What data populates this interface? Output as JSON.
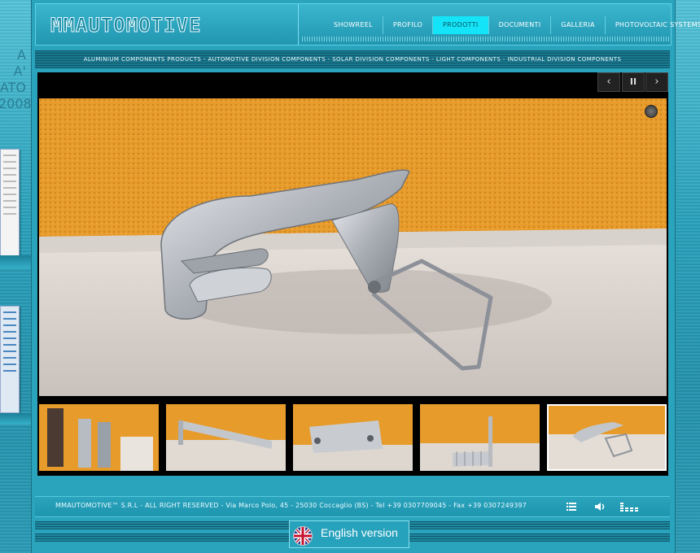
{
  "brand": {
    "logo_text": "MMAUTOMOTIVE"
  },
  "left_panel": {
    "text_lines": [
      "A",
      "A'",
      "ATO",
      "2008"
    ]
  },
  "nav": {
    "items": [
      {
        "label": "Showreel"
      },
      {
        "label": "Profilo"
      },
      {
        "label": "Prodotti"
      },
      {
        "label": "Documenti"
      },
      {
        "label": "Galleria"
      },
      {
        "label": "Photovoltaic Systems"
      }
    ],
    "active": "Prodotti"
  },
  "subnav": {
    "text": "Aluminium components products - automotive division components - solar division components - light  components  -  industrial division components"
  },
  "slider": {
    "prev_label": "‹",
    "pause_label": "II",
    "next_label": "›",
    "thumbnail_count": 5,
    "active_thumbnail": 5
  },
  "footer": {
    "copyright": "MMAUTOMOTIVE™ S.R.L - ALL RIGHT RESERVED  -  Via Marco Polo, 45 - 25030 Coccaglio (BS)  -  Tel  +39 0307709045  -  Fax +39 0307249397"
  },
  "language_button": {
    "label": "English version"
  },
  "colors": {
    "accent": "#14e4f7",
    "background": "#2aa3bd",
    "wall_orange": "#e79b2b"
  },
  "icons": [
    "list-icon",
    "volume-icon",
    "equalizer-icon",
    "uk-flag-icon",
    "timer-icon"
  ]
}
